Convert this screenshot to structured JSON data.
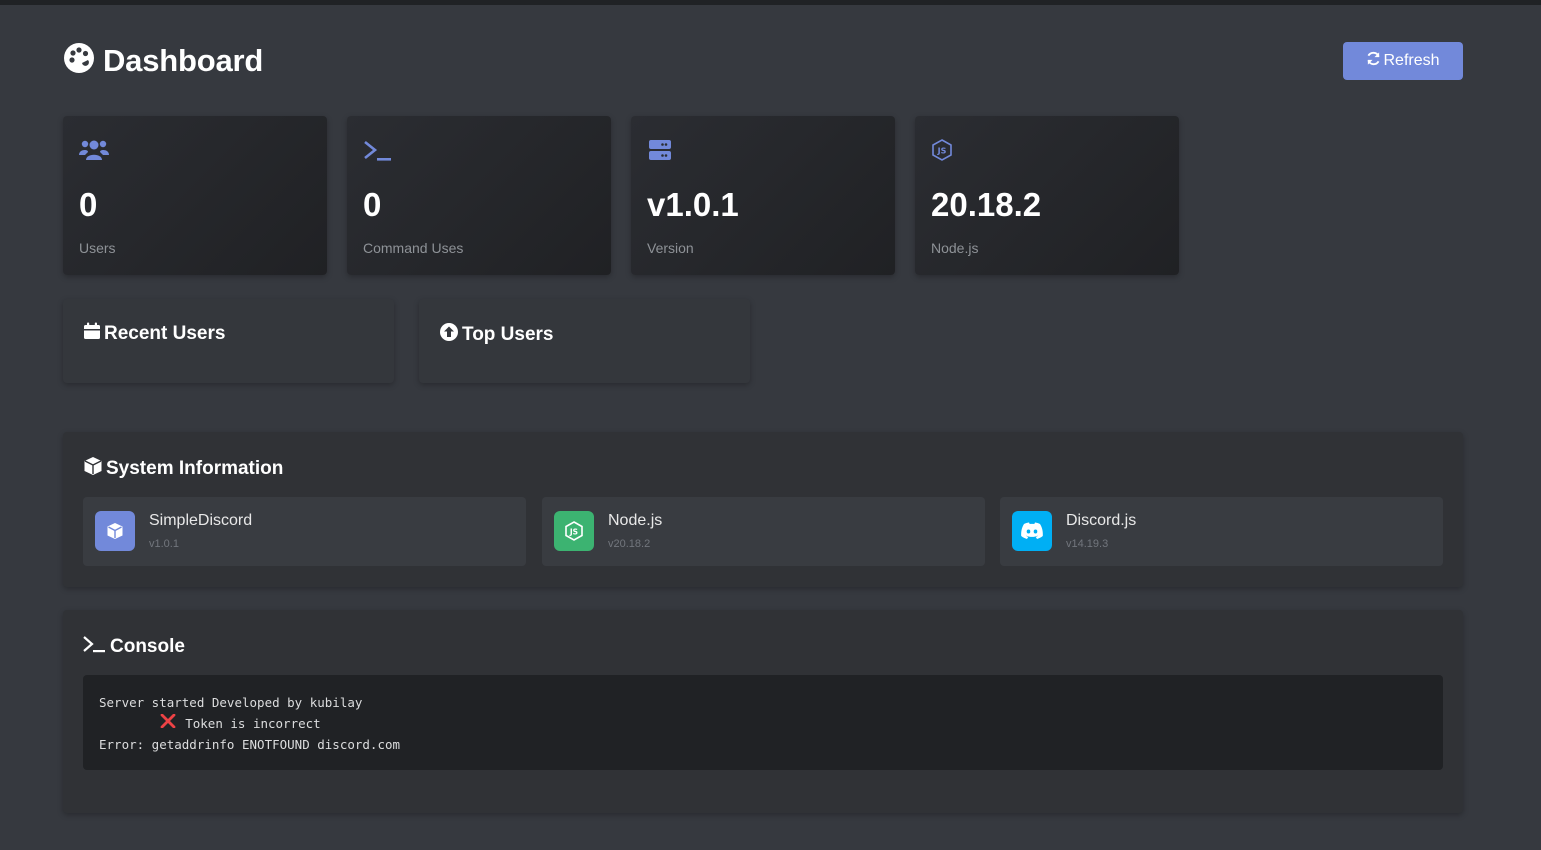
{
  "header": {
    "title": "Dashboard",
    "refresh_label": "Refresh"
  },
  "stats": [
    {
      "icon": "users-icon",
      "value": "0",
      "label": "Users"
    },
    {
      "icon": "terminal-icon",
      "value": "0",
      "label": "Command Uses"
    },
    {
      "icon": "server-icon",
      "value": "v1.0.1",
      "label": "Version"
    },
    {
      "icon": "nodejs-icon",
      "value": "20.18.2",
      "label": "Node.js"
    }
  ],
  "recent_users": {
    "title": "Recent Users",
    "icon": "calendar-icon"
  },
  "top_users": {
    "title": "Top Users",
    "icon": "arrow-up-circle-icon"
  },
  "system_info": {
    "title": "System Information",
    "items": [
      {
        "name": "SimpleDiscord",
        "version": "v1.0.1",
        "icon": "cube-icon",
        "color": "#7289da"
      },
      {
        "name": "Node.js",
        "version": "v20.18.2",
        "icon": "nodejs-icon",
        "color": "#3cb371"
      },
      {
        "name": "Discord.js",
        "version": "v14.19.3",
        "icon": "discord-icon",
        "color": "#00aff4"
      }
    ]
  },
  "console": {
    "title": "Console",
    "lines": [
      {
        "text": "Server started Developed by kubilay",
        "icon": null
      },
      {
        "text": "Token is incorrect",
        "icon": "cross-icon"
      },
      {
        "text": "Error: getaddrinfo ENOTFOUND discord.com",
        "icon": null
      }
    ]
  },
  "colors": {
    "background": "#36393f",
    "accent": "#7289da",
    "node_green": "#3cb371",
    "discord_blue": "#00aff4",
    "error_red": "#ed4245"
  }
}
